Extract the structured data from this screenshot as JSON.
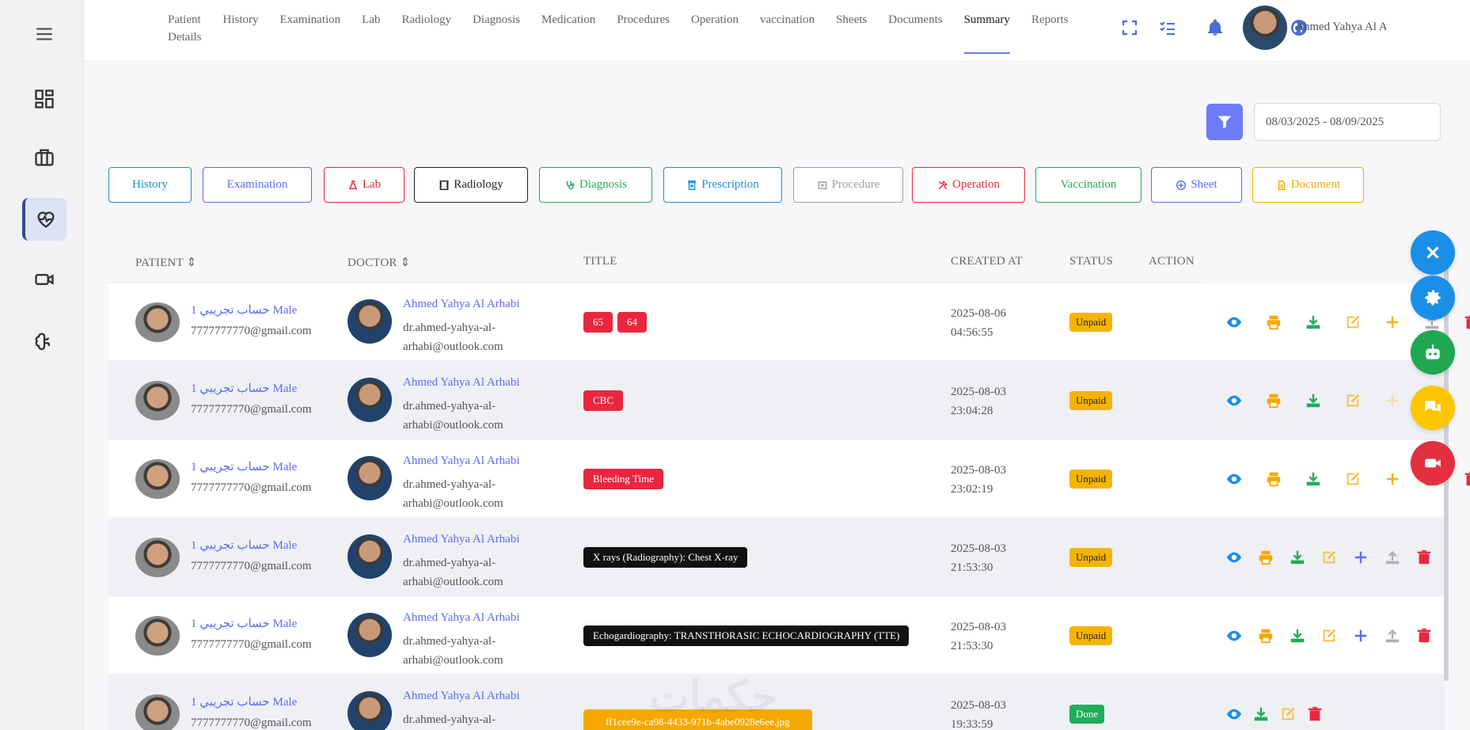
{
  "nav": {
    "items": [
      {
        "label": "Patient\nDetails"
      },
      {
        "label": "History"
      },
      {
        "label": "Examination"
      },
      {
        "label": "Lab"
      },
      {
        "label": "Radiology"
      },
      {
        "label": "Diagnosis"
      },
      {
        "label": "Medication"
      },
      {
        "label": "Procedures"
      },
      {
        "label": "Operation"
      },
      {
        "label": "vaccination"
      },
      {
        "label": "Sheets"
      },
      {
        "label": "Documents"
      },
      {
        "label": "Summary",
        "active": true
      },
      {
        "label": "Reports"
      }
    ]
  },
  "user": {
    "name": "Ahmed Yahya Al Arhabi"
  },
  "filter": {
    "date_range": "08/03/2025 - 08/09/2025"
  },
  "pills": [
    {
      "label": "History",
      "color": "#1a8fd8"
    },
    {
      "label": "Examination",
      "color": "#5b6cf0"
    },
    {
      "label": "Lab",
      "color": "#e8273f",
      "icon": "flask-icon"
    },
    {
      "label": "Radiology",
      "color": "#222222",
      "icon": "film-icon"
    },
    {
      "label": "Diagnosis",
      "color": "#1fae5a",
      "icon": "stethoscope-icon"
    },
    {
      "label": "Prescription",
      "color": "#1a8fd8",
      "icon": "prescription-bottle-icon"
    },
    {
      "label": "Procedure",
      "color": "#9aa0a8",
      "icon": "procedure-icon"
    },
    {
      "label": "Operation",
      "color": "#e8273f",
      "icon": "tools-icon"
    },
    {
      "label": "Vaccination",
      "color": "#1fae5a"
    },
    {
      "label": "Sheet",
      "color": "#5b6cf0",
      "icon": "plus-circle-icon"
    },
    {
      "label": "Document",
      "color": "#f5a800",
      "icon": "file-icon"
    }
  ],
  "table": {
    "headers": {
      "patient": "PATIENT",
      "doctor": "DOCTOR",
      "title": "TITLE",
      "created": "CREATED AT",
      "status": "STATUS",
      "action": "ACTION"
    },
    "rows": [
      {
        "patient_name": "حساب تجريبي 1 Male",
        "patient_email": "7777777770@gmail.com",
        "doctor_name": "Ahmed Yahya Al Arhabi",
        "doctor_email": "dr.ahmed-yahya-al-arhabi@outlook.com",
        "tags": [
          {
            "text": "65",
            "color": "#e8273f"
          },
          {
            "text": "64",
            "color": "#e8273f"
          }
        ],
        "created": "2025-08-06\n04:56:55",
        "status": "Unpaid"
      },
      {
        "patient_name": "حساب تجريبي 1 Male",
        "patient_email": "7777777770@gmail.com",
        "doctor_name": "Ahmed Yahya Al Arhabi",
        "doctor_email": "dr.ahmed-yahya-al-arhabi@outlook.com",
        "tags": [
          {
            "text": "CBC",
            "color": "#e8273f"
          }
        ],
        "created": "2025-08-03\n23:04:28",
        "status": "Unpaid"
      },
      {
        "patient_name": "حساب تجريبي 1 Male",
        "patient_email": "7777777770@gmail.com",
        "doctor_name": "Ahmed Yahya Al Arhabi",
        "doctor_email": "dr.ahmed-yahya-al-arhabi@outlook.com",
        "tags": [
          {
            "text": "Bleeding Time",
            "color": "#e8273f"
          }
        ],
        "created": "2025-08-03\n23:02:19",
        "status": "Unpaid"
      },
      {
        "patient_name": "حساب تجريبي 1 Male",
        "patient_email": "7777777770@gmail.com",
        "doctor_name": "Ahmed Yahya Al Arhabi",
        "doctor_email": "dr.ahmed-yahya-al-arhabi@outlook.com",
        "tags": [
          {
            "text": "X rays (Radiography): Chest X-ray",
            "color": "#111111"
          }
        ],
        "created": "2025-08-03\n21:53:30",
        "status": "Unpaid"
      },
      {
        "patient_name": "حساب تجريبي 1 Male",
        "patient_email": "7777777770@gmail.com",
        "doctor_name": "Ahmed Yahya Al Arhabi",
        "doctor_email": "dr.ahmed-yahya-al-arhabi@outlook.com",
        "tags": [
          {
            "text": "Echogardiography: TRANSTHORASIC ECHOCARDIOGRAPHY (TTE)",
            "color": "#111111"
          }
        ],
        "created": "2025-08-03\n21:53:30",
        "status": "Unpaid"
      },
      {
        "patient_name": "حساب تجريبي 1 Male",
        "patient_email": "7777777770@gmail.com",
        "doctor_name": "Ahmed Yahya Al Arhabi",
        "doctor_email": "dr.ahmed-yahya-al-arhabi@outlook.com",
        "tags": [
          {
            "text": "ff1cee9e-ca98-4433-971b-4abe0928e6ee.jpg",
            "color": "#f5a800"
          }
        ],
        "created": "2025-08-03\n19:33:59",
        "status": "Done"
      }
    ]
  },
  "colors": {
    "accent": "#6c7cf8",
    "unpaid": "#f5b400",
    "done": "#1fae5a",
    "link": "#5b6cf0"
  }
}
